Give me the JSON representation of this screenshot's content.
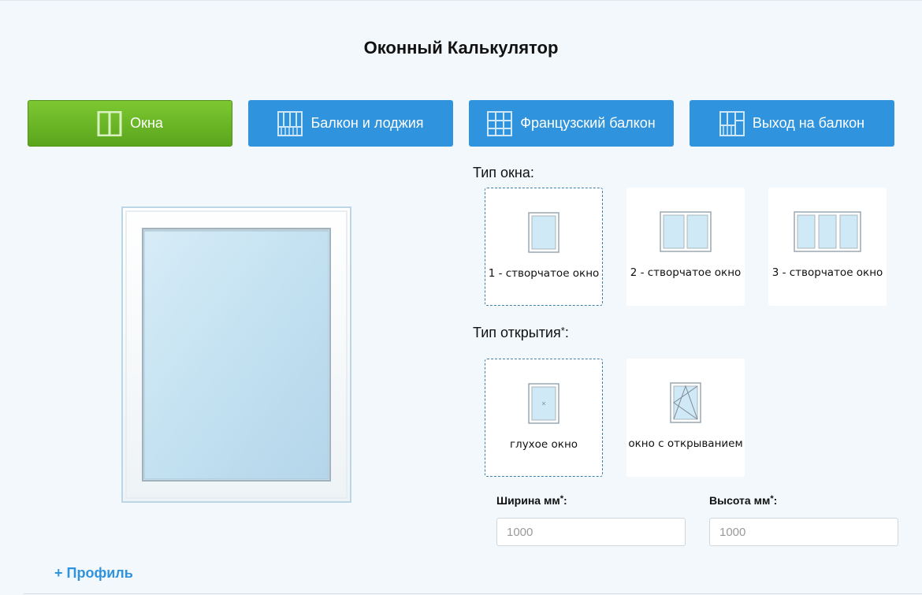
{
  "page": {
    "title": "Оконный Калькулятор"
  },
  "tabs": [
    {
      "label": "Окна",
      "icon": "single-window-icon",
      "active": true
    },
    {
      "label": "Балкон и лоджия",
      "icon": "balcony-icon",
      "active": false
    },
    {
      "label": "Французский балкон",
      "icon": "french-balcony-icon",
      "active": false
    },
    {
      "label": "Выход на балкон",
      "icon": "balcony-door-icon",
      "active": false
    }
  ],
  "window_type": {
    "label": "Тип окна:",
    "options": [
      {
        "label": "1 - створчатое окно",
        "selected": true
      },
      {
        "label": "2 - створчатое окно",
        "selected": false
      },
      {
        "label": "3 - створчатое окно",
        "selected": false
      }
    ]
  },
  "opening_type": {
    "label": "Тип открытия",
    "required_mark": "*",
    "suffix": ":",
    "options": [
      {
        "label": "глухое окно",
        "selected": true
      },
      {
        "label": "окно с открыванием",
        "selected": false
      }
    ]
  },
  "dimensions": {
    "width": {
      "label": "Ширина мм",
      "required_mark": "*",
      "suffix": ":",
      "placeholder": "1000"
    },
    "height": {
      "label": "Высота мм",
      "required_mark": "*",
      "suffix": ":",
      "placeholder": "1000"
    }
  },
  "profile_link": "+ Профиль",
  "colors": {
    "active_tab": "#6cb82a",
    "tab": "#2f93dd",
    "accent_link": "#2f93dd",
    "background": "#f3f8fc"
  }
}
